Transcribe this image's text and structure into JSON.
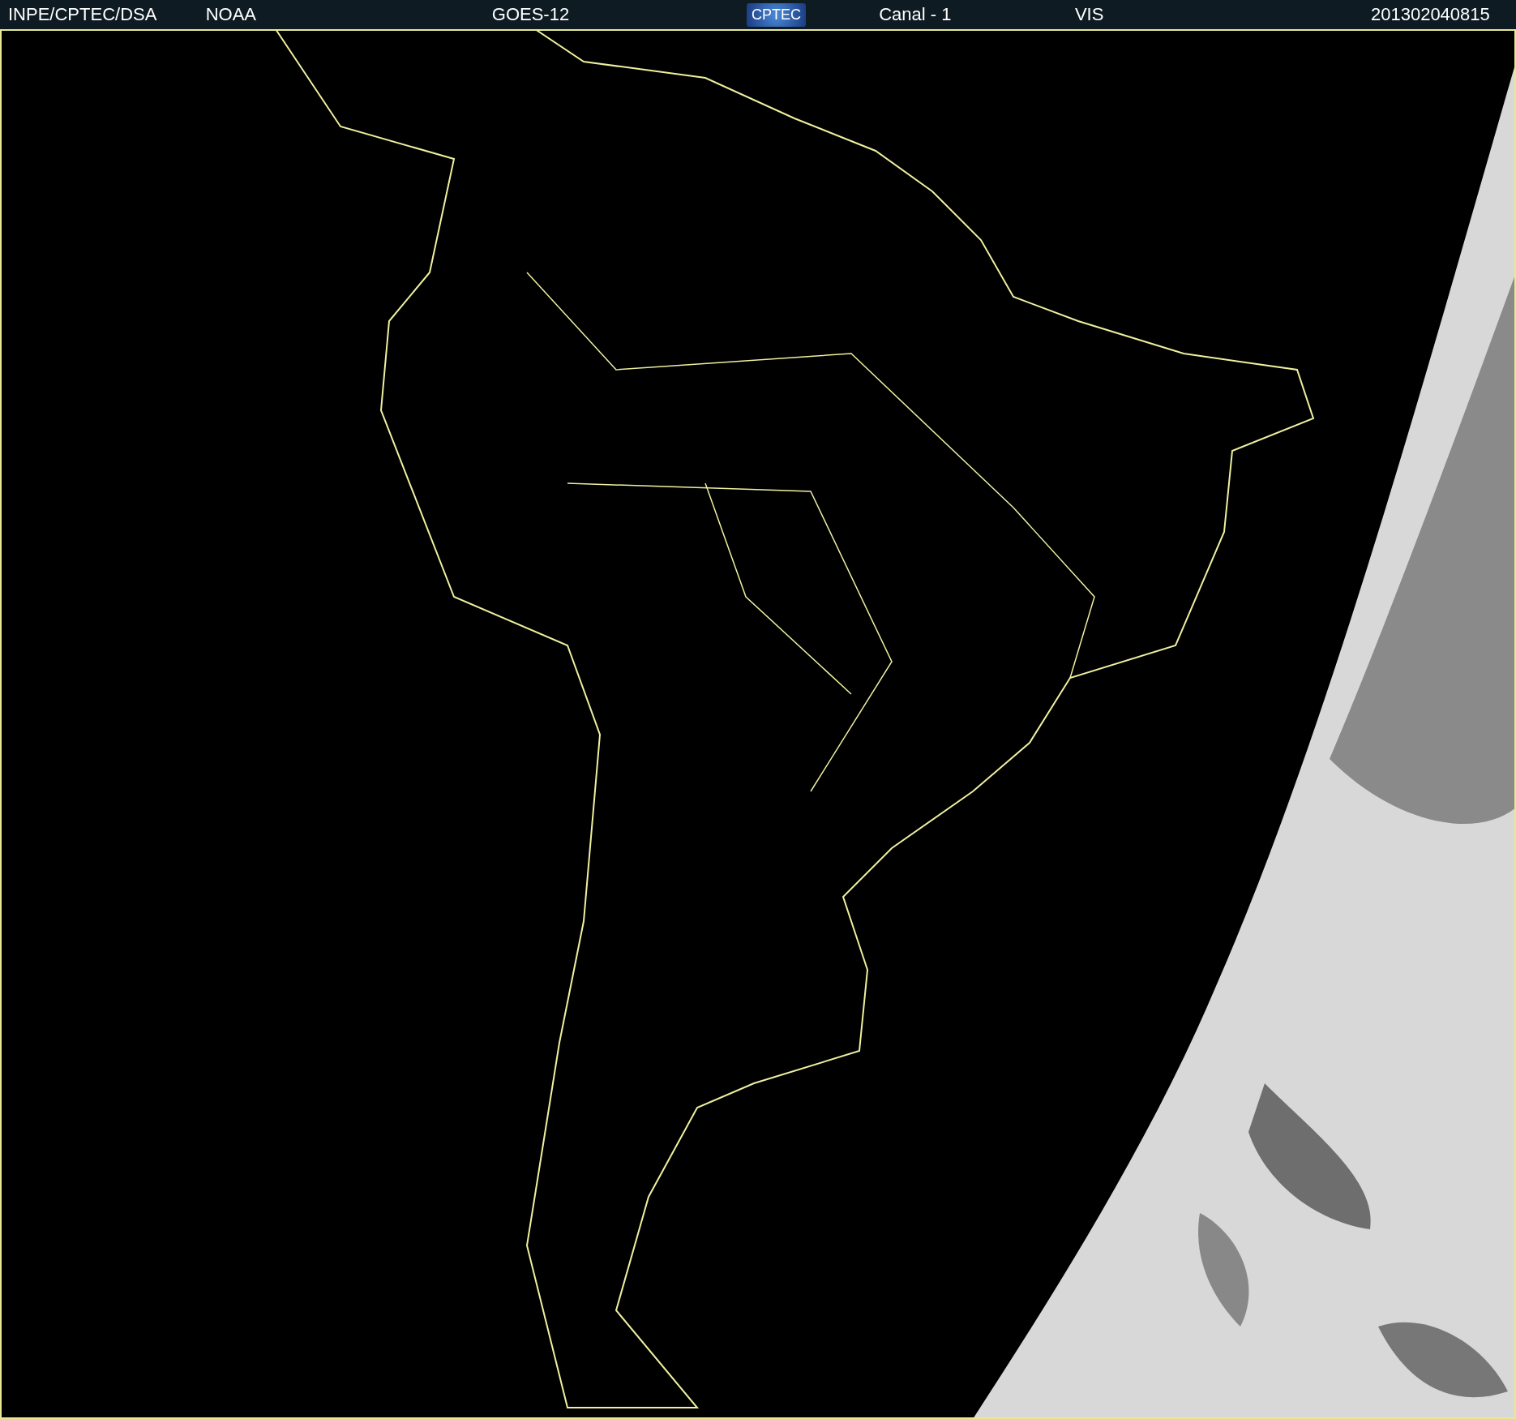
{
  "header": {
    "items": [
      {
        "kind": "text",
        "text": "INPE/CPTEC/DSA"
      },
      {
        "kind": "text",
        "text": "NOAA"
      },
      {
        "kind": "text",
        "text": "GOES-12"
      },
      {
        "kind": "logo",
        "text": "CPTEC"
      },
      {
        "kind": "text",
        "text": "Canal - 1"
      },
      {
        "kind": "text",
        "text": "VIS"
      },
      {
        "kind": "text",
        "text": "201302040815"
      }
    ]
  }
}
